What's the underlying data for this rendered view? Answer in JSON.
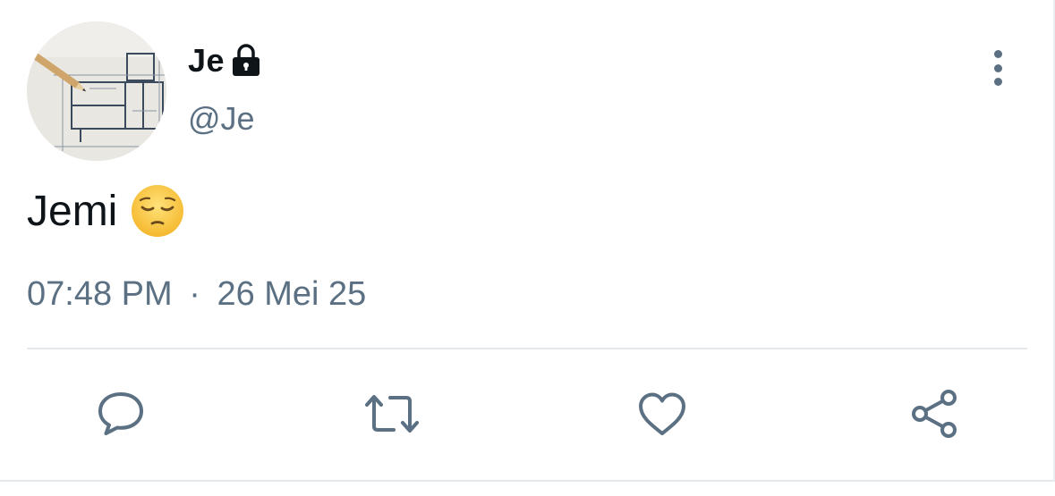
{
  "tweet": {
    "author": {
      "display_name": "Je",
      "handle": "@Je",
      "avatar_icon": "floor-plan-with-pencil-avatar",
      "protected_icon": "lock-icon"
    },
    "text": "Jemi",
    "emoji": "pensive-face-emoji",
    "time": "07:48 PM",
    "separator": "·",
    "date": "26 Mei 25"
  },
  "actions": [
    {
      "name": "reply",
      "icon": "reply-icon"
    },
    {
      "name": "retweet",
      "icon": "retweet-icon"
    },
    {
      "name": "like",
      "icon": "heart-icon"
    },
    {
      "name": "share",
      "icon": "share-icon"
    }
  ],
  "menu": {
    "icon": "more-vertical-icon"
  },
  "colors": {
    "text_primary": "#0f1419",
    "text_secondary": "#5b7083",
    "divider": "#e6e9ec",
    "background": "#ffffff"
  }
}
